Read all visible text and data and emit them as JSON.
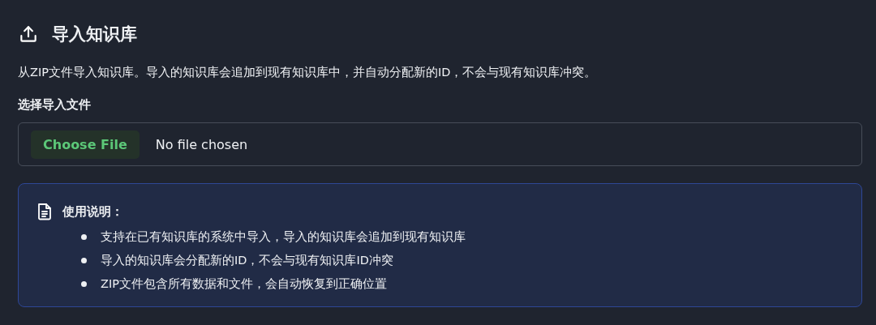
{
  "header": {
    "title": "导入知识库"
  },
  "description": "从ZIP文件导入知识库。导入的知识库会追加到现有知识库中，并自动分配新的ID，不会与现有知识库冲突。",
  "file_field": {
    "label": "选择导入文件",
    "button": "Choose File",
    "value": "No file chosen"
  },
  "notice": {
    "title": "使用说明：",
    "items": [
      "支持在已有知识库的系统中导入，导入的知识库会追加到现有知识库",
      "导入的知识库会分配新的ID，不会与现有知识库ID冲突",
      "ZIP文件包含所有数据和文件，会自动恢复到正确位置"
    ]
  }
}
